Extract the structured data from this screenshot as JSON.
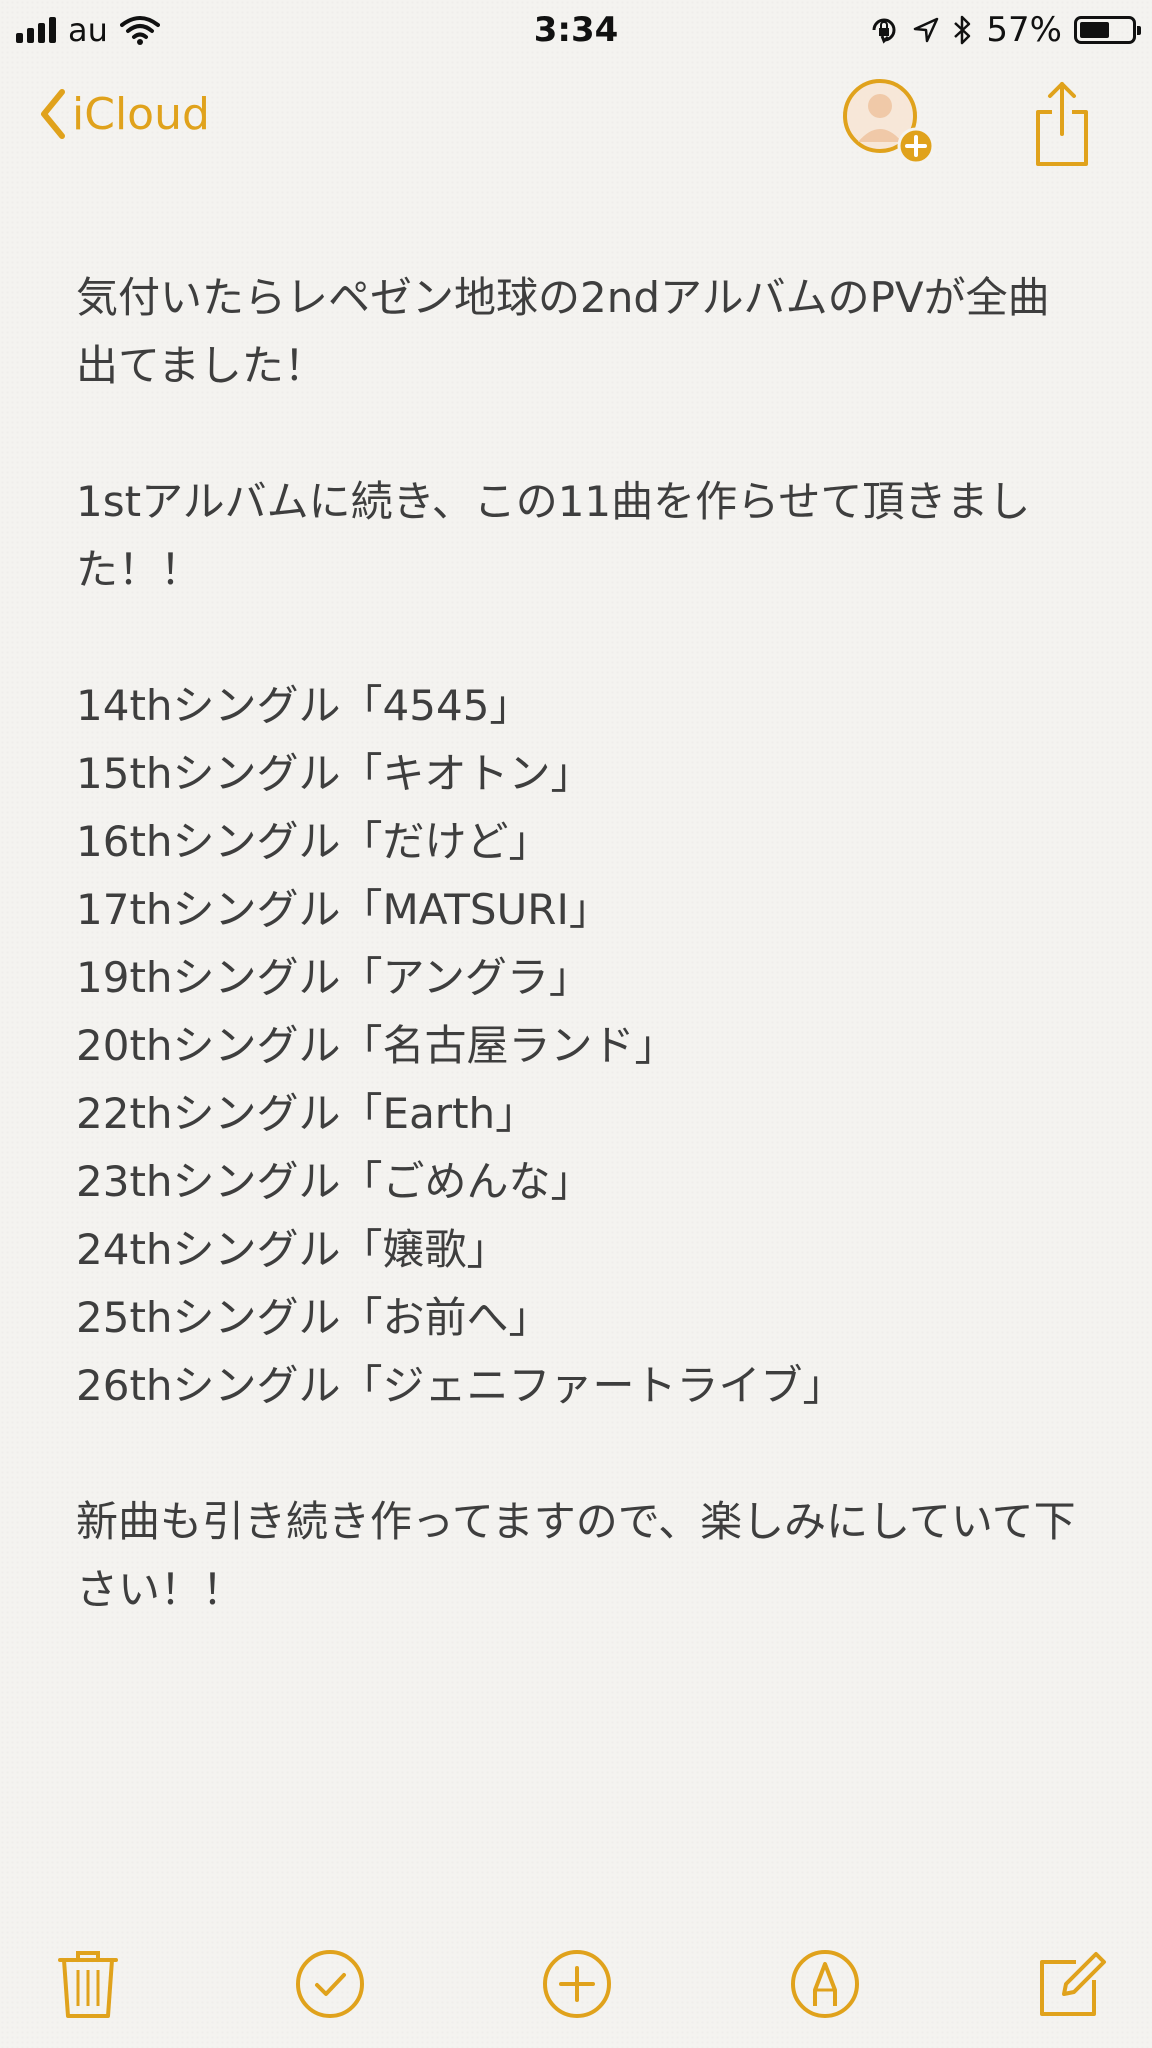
{
  "status_bar": {
    "carrier": "au",
    "time": "3:34",
    "battery_percent": "57%",
    "battery_level": 0.57,
    "icons": [
      "signal-icon",
      "wifi-icon",
      "orientation-lock-icon",
      "location-icon",
      "bluetooth-icon",
      "battery-icon"
    ]
  },
  "nav": {
    "back_label": "iCloud",
    "icons": [
      "chevron-left-icon",
      "add-person-icon",
      "share-icon"
    ]
  },
  "note": {
    "paragraph_1": "気付いたらレペゼン地球の2ndアルバムのPVが全曲出てました！",
    "paragraph_2": "1stアルバムに続き、この11曲を作らせて頂きました！！",
    "songs": [
      "14thシングル「4545」",
      "15thシングル「キオトン」",
      "16thシングル「だけど」",
      "17thシングル「MATSURI」",
      "19thシングル「アングラ」",
      "20thシングル「名古屋ランド」",
      "22thシングル「Earth」",
      "23thシングル「ごめんな」",
      "24thシングル「嬢歌」",
      "25thシングル「お前へ」",
      "26thシングル「ジェニファートライブ」"
    ],
    "paragraph_3": "新曲も引き続き作ってますので、楽しみにしていて下さい！！"
  },
  "toolbar": {
    "icons": [
      "trash-icon",
      "checklist-icon",
      "add-icon",
      "markup-icon",
      "compose-icon"
    ]
  },
  "colors": {
    "accent": "#e0a21c",
    "background": "#f4f3f0",
    "text": "#3e3e3e"
  }
}
